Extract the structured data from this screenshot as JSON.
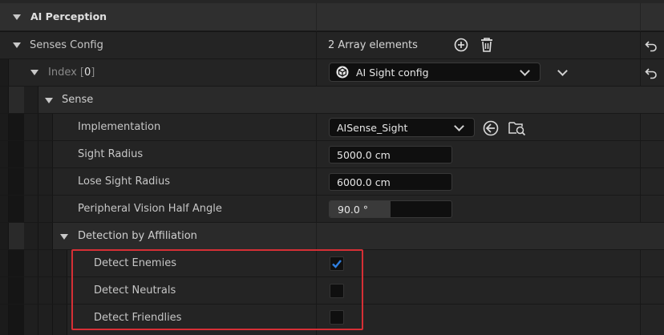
{
  "section": {
    "title": "AI Perception"
  },
  "senses_config": {
    "label": "Senses Config",
    "value": "2 Array elements"
  },
  "index_row": {
    "label_prefix": "Index [",
    "index": "0",
    "label_suffix": "]",
    "selected": "AI Sight config"
  },
  "sense": {
    "label": "Sense"
  },
  "implementation": {
    "label": "Implementation",
    "value": "AISense_Sight"
  },
  "sight_radius": {
    "label": "Sight Radius",
    "value": "5000.0 cm"
  },
  "lose_sight_radius": {
    "label": "Lose Sight Radius",
    "value": "6000.0 cm"
  },
  "peripheral": {
    "label": "Peripheral Vision Half Angle",
    "value": "90.0 °",
    "slider_fraction": 0.5
  },
  "detection": {
    "label": "Detection by Affiliation",
    "items": [
      {
        "label": "Detect Enemies",
        "checked": true
      },
      {
        "label": "Detect Neutrals",
        "checked": false
      },
      {
        "label": "Detect Friendlies",
        "checked": false
      }
    ]
  },
  "colors": {
    "accent": "#2f7fe0",
    "highlight": "#d62f35"
  },
  "icons": [
    "reset-arrow-icon",
    "add-circle-icon",
    "trash-icon",
    "asset-cube-icon",
    "use-selected-arrow-icon",
    "browse-asset-icon"
  ]
}
